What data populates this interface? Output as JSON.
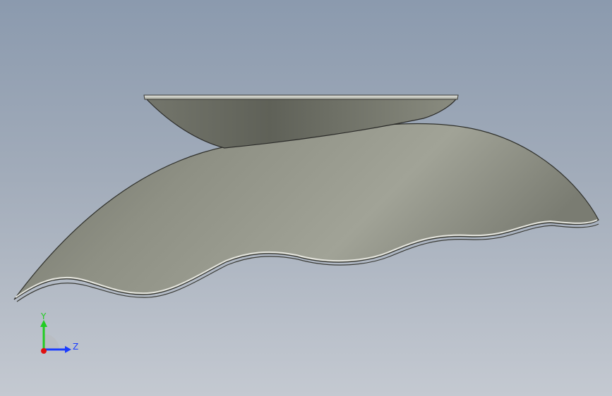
{
  "viewport": {
    "background_top": "#8b9aae",
    "background_bottom": "#c4c9d1"
  },
  "model": {
    "part_color": "#8f9185",
    "edge_color": "#2a2a28"
  },
  "triad": {
    "y_label": "Y",
    "z_label": "Z",
    "y_color": "#22cc22",
    "z_color": "#1a3cff",
    "x_color": "#e01010"
  }
}
